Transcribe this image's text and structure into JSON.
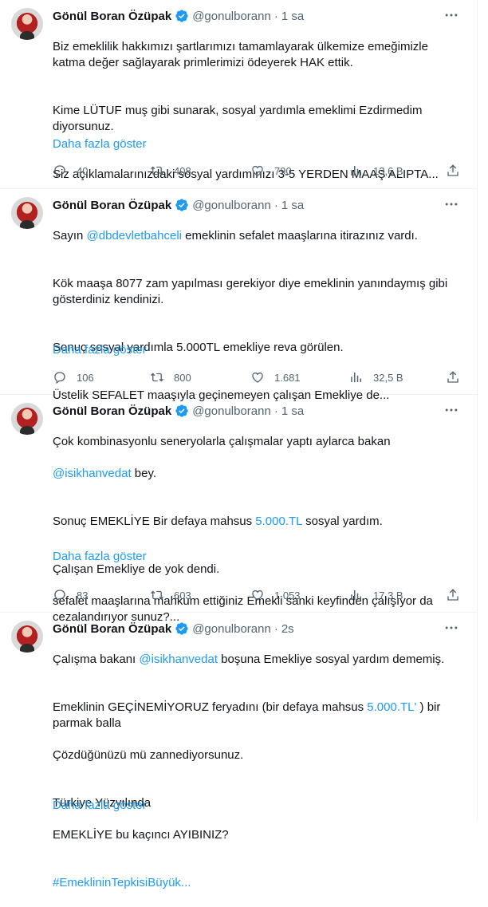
{
  "tweets": [
    {
      "author": "Gönül Boran Özüpak",
      "handle": "@gonulborann",
      "time": "1 sa",
      "paragraphs": [
        "Biz emeklilik hakkımızı şartlarımızı tamamlayarak  ülkemize emeğimizle katma değer sağlayarak primlerimizi ödeyerek HAK ettik.",
        "Kime LÜTUF muş  gibi sunarak, sosyal yardımla emeklimi Ezdirmedim diyorsunuz.",
        "Siz açıklamalarınızdaki sosyal yardımınızı 3-5 YERDEN MAAŞ ALIPTA..."
      ],
      "show_more": "Daha fazla göster",
      "replies": "40",
      "retweets": "408",
      "likes": "790",
      "views": "13,6 B"
    },
    {
      "author": "Gönül Boran Özüpak",
      "handle": "@gonulborann",
      "time": "1 sa",
      "mention": "@dbdevletbahceli",
      "p1_prefix": "Sayın ",
      "p1_suffix": "  emeklinin sefalet maaşlarına itirazınız vardı.",
      "paragraphs": [
        "Kök maaşa 8077 zam yapılması gerekiyor diye emeklinin yanındaymış gibi gösterdiniz kendinizi.",
        "Sonuç sosyal yardımla 5.000TL emekliye reva görülen.",
        "Üstelik SEFALET maaşıyla geçinemeyen çalışan Emekliye de..."
      ],
      "show_more": "Daha fazla göster",
      "replies": "106",
      "retweets": "800",
      "likes": "1.681",
      "views": "32,5 B"
    },
    {
      "author": "Gönül Boran Özüpak",
      "handle": "@gonulborann",
      "time": "1 sa",
      "p1": "Çok kombinasyonlu seneryolarla çalışmalar yaptı aylarca bakan",
      "mention": "@isikhanvedat",
      "p1_suffix": " bey.",
      "p2_prefix": "Sonuç EMEKLİYE Bir defaya mahsus ",
      "p2_link": "5.000.TL",
      "p2_suffix": " sosyal yardım.",
      "p3": "Çalışan Emekliye de yok dendi.",
      "p4": "sefalet maaşlarına mahkum ettiğiniz Emekli sanki keyfinden çalışıyor da cezalandırıyor sunuz?...",
      "show_more": "Daha fazla göster",
      "replies": "83",
      "retweets": "603",
      "likes": "1.053",
      "views": "17,3 B"
    },
    {
      "author": "Gönül Boran Özüpak",
      "handle": "@gonulborann",
      "time": "2s",
      "p1_prefix": "Çalışma bakanı ",
      "mention": "@isikhanvedat",
      "p1_suffix": " boşuna Emekliye sosyal yardım dememiş.",
      "p2_prefix": "Emeklinin GEÇİNEMİYORUZ feryadını (bir defaya mahsus ",
      "p2_link": "5.000.TL'",
      "p2_suffix": " ) bir parmak balla",
      "p3": "Çözdüğünüzü mü zannediyorsunuz.",
      "p4": "Türkiye Yüzyılında",
      "p5": "EMEKLİYE bu kaçıncı AYIBINIZ?",
      "hashtag": "#EmeklininTepkisiBüyük...",
      "show_more": "Daha fazla göster"
    }
  ],
  "colors": {
    "accent": "#1d9bf0",
    "muted": "#536471",
    "text": "#0f1419",
    "border": "#eff3f4"
  },
  "icons": [
    "verified-badge-icon",
    "more-dots-icon",
    "reply-icon",
    "retweet-icon",
    "like-icon",
    "views-icon",
    "share-icon"
  ]
}
